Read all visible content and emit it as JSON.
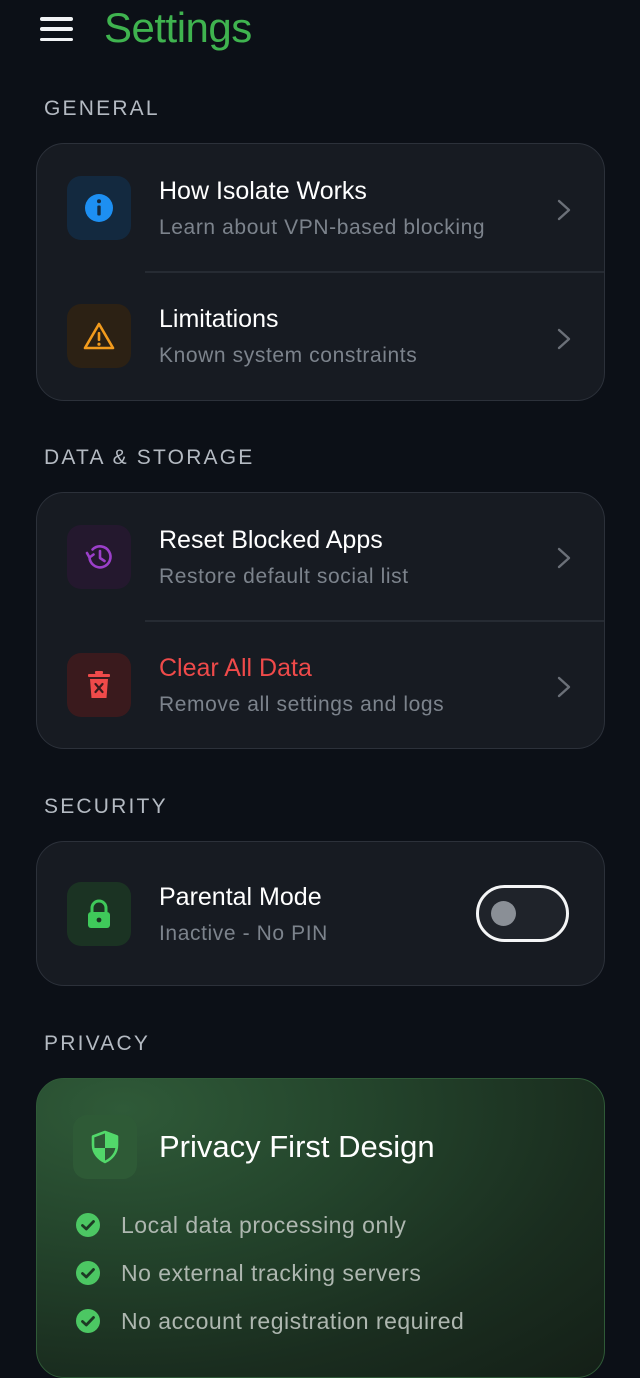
{
  "header": {
    "title": "Settings"
  },
  "sections": {
    "general": {
      "label": "GENERAL",
      "items": [
        {
          "title": "How Isolate Works",
          "subtitle": "Learn about VPN-based blocking",
          "icon": "info-icon"
        },
        {
          "title": "Limitations",
          "subtitle": "Known system constraints",
          "icon": "warning-icon"
        }
      ]
    },
    "data_storage": {
      "label": "DATA & STORAGE",
      "items": [
        {
          "title": "Reset Blocked Apps",
          "subtitle": "Restore default social list",
          "icon": "history-icon"
        },
        {
          "title": "Clear All Data",
          "subtitle": "Remove all settings and logs",
          "icon": "trash-icon"
        }
      ]
    },
    "security": {
      "label": "SECURITY",
      "parental": {
        "title": "Parental Mode",
        "subtitle": "Inactive - No PIN",
        "icon": "lock-icon",
        "enabled": false
      }
    },
    "privacy": {
      "label": "PRIVACY",
      "card": {
        "title": "Privacy First Design",
        "icon": "shield-icon",
        "items": [
          "Local data processing only",
          "No external tracking servers",
          "No account registration required"
        ]
      }
    }
  },
  "colors": {
    "accent_green": "#3fb34f",
    "info_blue": "#1d8ff2",
    "warning_orange": "#f29b1d",
    "history_purple": "#9b3fc9",
    "danger_red": "#ef4a4a",
    "background": "#0c1017",
    "card": "#171b22"
  }
}
